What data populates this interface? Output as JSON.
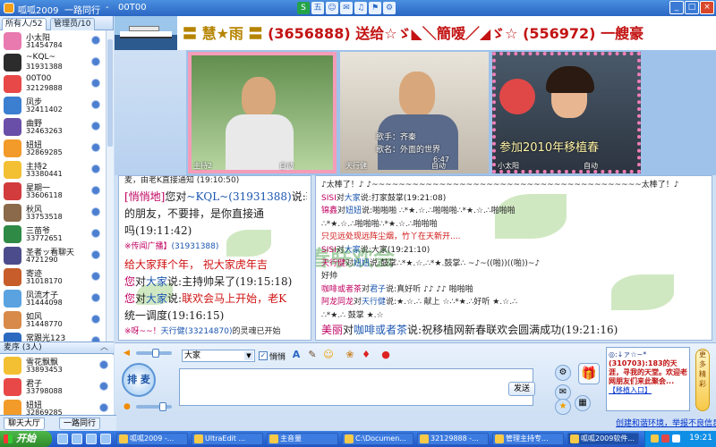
{
  "window": {
    "app_title": "呱呱2009",
    "room": "一路同行",
    "room_id": "00T00",
    "tool_badge": "五"
  },
  "left_panel": {
    "tab_all": "所有人/52",
    "tab_admin": "管理员/10",
    "users": [
      {
        "name": "小太阳",
        "id": "31454784",
        "color": "#e87ab0"
      },
      {
        "name": "~KQL~",
        "id": "31931388",
        "color": "#2c2c2c"
      },
      {
        "name": "00T00",
        "id": "32129888",
        "color": "#e84848"
      },
      {
        "name": "凤步",
        "id": "32411402",
        "color": "#3c7fd0"
      },
      {
        "name": "曲野",
        "id": "32463263",
        "color": "#6a4fa8"
      },
      {
        "name": "妞妞",
        "id": "32869285",
        "color": "#f29b2a"
      },
      {
        "name": "主持2",
        "id": "33380441",
        "color": "#f3c033"
      },
      {
        "name": "星期一",
        "id": "33606118",
        "color": "#d23c3c"
      },
      {
        "name": "秋风",
        "id": "33753518",
        "color": "#8a6a4a"
      },
      {
        "name": "三苗爷",
        "id": "33772651",
        "color": "#2f8a46"
      },
      {
        "name": "圣者ッ看聊天",
        "id": "4721290",
        "color": "#4c4c8c"
      },
      {
        "name": "寄迹",
        "id": "31018170",
        "color": "#c75d2b"
      },
      {
        "name": "凤流才子",
        "id": "31444098",
        "color": "#5aa2e0"
      },
      {
        "name": "如风",
        "id": "31448770",
        "color": "#d88a4a"
      },
      {
        "name": "常跟光123",
        "id": "31619255",
        "color": "#2c6ac0"
      },
      {
        "name": "逸之",
        "id": "31710548",
        "color": "#8fb84a"
      },
      {
        "name": "千帆",
        "id": "",
        "color": "#e84848"
      }
    ],
    "queue_label": "麦序 (3人)",
    "queue": [
      {
        "name": "雪花飘飘",
        "id": "33893453",
        "color": "#f3c033"
      },
      {
        "name": "君子",
        "id": "33798088",
        "color": "#e84848"
      },
      {
        "name": "妞妞",
        "id": "32869285",
        "color": "#f29b2a"
      }
    ],
    "bottom_tab_hall": "聊天大厅",
    "bottom_tab_room": "一路同行"
  },
  "banner": {
    "text_part1": "〓 慧★雨 〓",
    "text_part2": "(3656888) 送给☆ゞ◣＼簡嗳／◢ゞ☆ (556972) 一艘豪"
  },
  "videos": [
    {
      "label": "主持2",
      "status": "自动"
    },
    {
      "label": "天行健",
      "status": "自动",
      "overlay1": "歌手：齐秦",
      "overlay2": "歌名：外面的世界",
      "overlay3": "6:47"
    },
    {
      "label": "小太阳",
      "status": "自动",
      "overlay1": "参加2010年移植春"
    }
  ],
  "chat_left": {
    "top_line": "麦，由老K直接通知 (19:10:50)",
    "msgs": [
      {
        "speaker": "[悄悄地]",
        "mid": "您对",
        "target": "~KQL~(31931388)",
        "verb": "说:",
        "text": "转告排麦"
      },
      {
        "text": "的朋友，不要排，是你直接通"
      },
      {
        "text": "吗",
        "time": "(19:11:42)"
      },
      {
        "speaker": "※传闻广播】",
        "target": "(31931388)",
        "text": ""
      },
      {
        "text": "给大家拜个年， 祝大家虎年吉"
      },
      {
        "speaker": "您",
        "mid": "对",
        "target": "大家",
        "verb": "说:",
        "text": "主持帅呆了",
        "time": "(19:15:18)"
      },
      {
        "speaker": "您",
        "mid": "对",
        "target": "大家",
        "verb": "说:",
        "text": "联欢会马上开始，老K"
      },
      {
        "text": "统一调度",
        "time": "(19:16:15)"
      },
      {
        "speaker": "※呀~~！",
        "target": "天行健(33214870)",
        "text": "的灵魂已开始"
      }
    ]
  },
  "chat_right": {
    "msgs": [
      {
        "text": "♪太棒了！♪ ♪~~~~~~~~~~~~~~~~~~~~~~~~~~~~~~~~~~~~~~~~太棒了！♪"
      },
      {
        "speaker": "SISI",
        "mid": "对",
        "target": "大家",
        "verb": "说:",
        "text": "打家鼓掌",
        "time": "(19:21:08)"
      },
      {
        "speaker": "锦鑫",
        "mid": "对",
        "target": "妞妞",
        "verb": "说:",
        "text": "啪啪啪 ∴*★.☆.∴啪啪啪∴*★.☆.∴啪啪啪"
      },
      {
        "text": "∴*★.☆.∴啪啪啪∴*★.☆.∴啪啪啪"
      },
      {
        "text": "只见远处现远阵尘烟，竹丫在天新开...."
      },
      {
        "speaker": "SISI",
        "mid": "对",
        "target": "大家",
        "verb": "说:",
        "text": "大家",
        "time": "(19:21:10)"
      },
      {
        "speaker": "天行健",
        "mid": "对",
        "target": "妞妞",
        "verb": "说:",
        "text": "鼓掌∴*★.☆.∴*★.鼓掌∴ ~♪~((啪))((啪))~♪"
      },
      {
        "text": "好帅"
      },
      {
        "speaker": "咖啡或者茶",
        "mid": "对",
        "target": "君子",
        "verb": "说:",
        "text": "真好听 ♪♪ ♪♪ 啪啪啪"
      },
      {
        "speaker": "阿龙同龙",
        "mid": "对",
        "target": "天行健",
        "verb": "说:",
        "text": "★.☆.∴ 献上 ☆∴*★.∴好听 ★.☆.∴"
      },
      {
        "text": "∴*★.∴ 鼓掌 ★.☆"
      },
      {
        "speaker": "美丽",
        "mid": "对",
        "target": "咖啡或者茶",
        "verb": "说:",
        "text": "祝移植网新春联欢会圆满成功",
        "time": "(19:21:16)"
      }
    ],
    "watermark": "植网新春联欢会"
  },
  "input": {
    "font_name": "大家",
    "whisper_label": "悄悄",
    "send_label": "发送",
    "mic_label": "排 麦",
    "ad_line1": "◎:↓ァ☆~*",
    "ad_line2": "(310703):183的天涯，寻我的天堂。欢迎老网朋友们来此聚会...",
    "ad_link": "【移植入口】",
    "ad_vbar": "更多精彩",
    "report_link": "创建和谐环境，举报不良信息"
  },
  "taskbar": {
    "start": "开始",
    "tasks": [
      "呱呱2009 -...",
      "UltraEdit ...",
      "主音量",
      "C:\\Documen...",
      "32129888 -...",
      "管理主持专...",
      "呱呱2009软件..."
    ],
    "clock": "19:21"
  },
  "colors": {
    "accent": "#2a66c4",
    "speaker": "#c00060",
    "target": "#1a55b0"
  }
}
